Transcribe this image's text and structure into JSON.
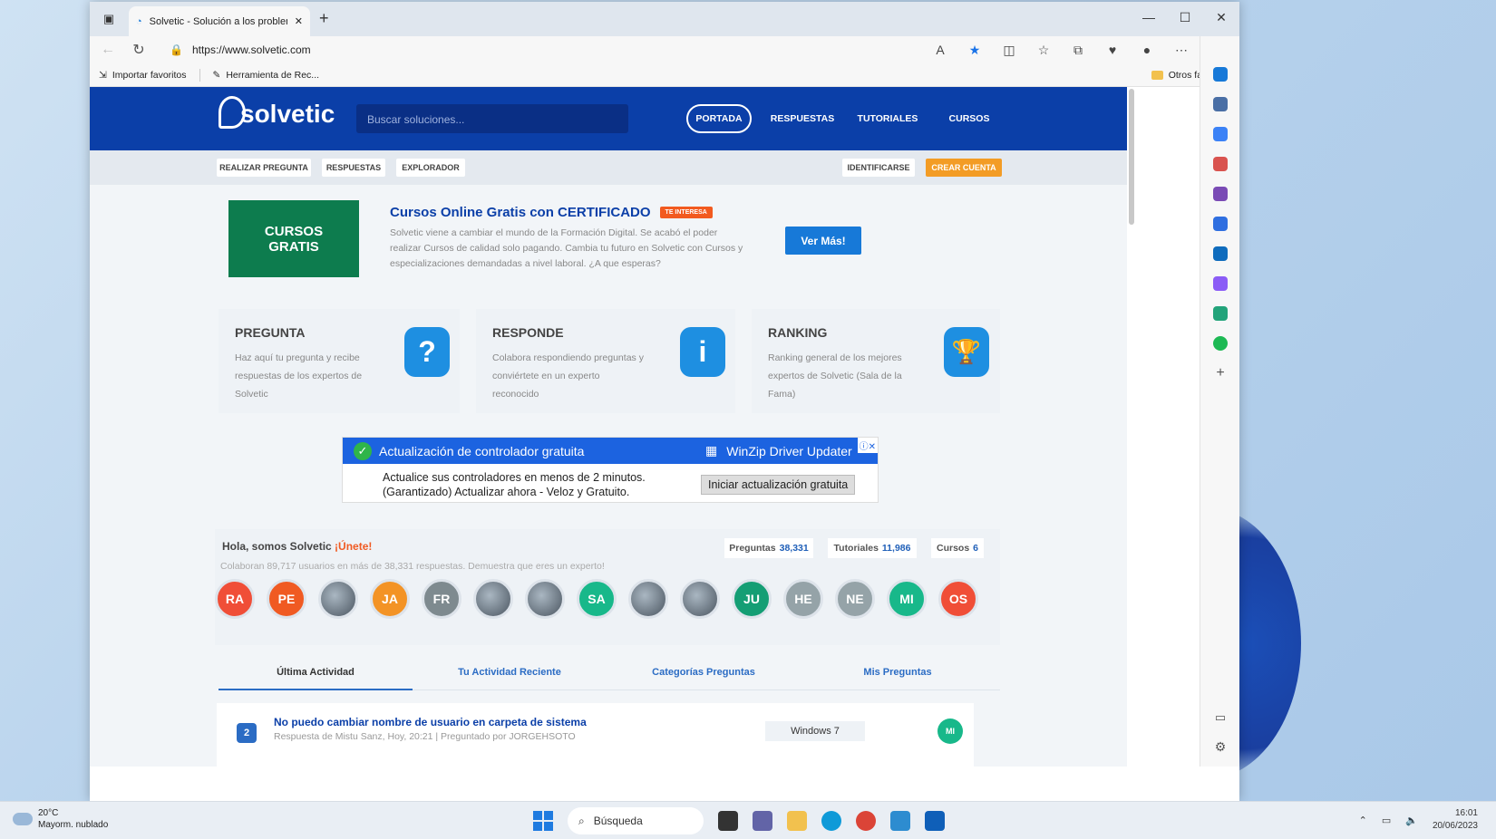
{
  "browser": {
    "tab_title": "Solvetic - Solución a los problem",
    "url": "https://www.solvetic.com",
    "favorites": [
      "Importar favoritos",
      "Herramienta de Rec..."
    ],
    "other_favorites": "Otros favoritos"
  },
  "site": {
    "search_placeholder": "Buscar soluciones...",
    "logo_text": "solvetic",
    "nav": [
      "PORTADA",
      "RESPUESTAS",
      "TUTORIALES",
      "CURSOS"
    ],
    "subnav": [
      "REALIZAR PREGUNTA",
      "RESPUESTAS",
      "EXPLORADOR"
    ],
    "login": "IDENTIFICARSE",
    "signup": "CREAR CUENTA"
  },
  "promo": {
    "image_text": "CURSOS GRATIS",
    "title": "Cursos Online Gratis con CERTIFICADO",
    "badge": "TE INTERESA",
    "body": "Solvetic viene a cambiar el mundo de la Formación Digital. Se acabó el poder realizar Cursos de calidad solo pagando. Cambia tu futuro en Solvetic con Cursos y especializaciones demandadas a nivel laboral. ¿A que esperas?",
    "button": "Ver Más!"
  },
  "cards": [
    {
      "title": "PREGUNTA",
      "body": "Haz aquí tu pregunta y recibe respuestas de los expertos de Solvetic",
      "icon": "?"
    },
    {
      "title": "RESPONDE",
      "body": "Colabora respondiendo preguntas y conviértete en un experto reconocido",
      "icon": "i"
    },
    {
      "title": "RANKING",
      "body": "Ranking general de los mejores expertos de Solvetic (Sala de la Fama)",
      "icon": "🏆"
    }
  ],
  "ad": {
    "headline": "Actualización de controlador gratuita",
    "brand": "WinZip Driver Updater",
    "body_line1": "Actualice sus controladores en menos de 2 minutos.",
    "body_line2": "(Garantizado) Actualizar ahora - Veloz y Gratuito.",
    "button": "Iniciar actualización gratuita"
  },
  "community": {
    "hello": "Hola, somos Solvetic",
    "join": "¡Únete!",
    "subtitle": "Colaboran 89,717 usuarios en más de 38,331 respuestas. Demuestra que eres un experto!",
    "stats": [
      {
        "label": "Preguntas",
        "value": "38,331"
      },
      {
        "label": "Tutoriales",
        "value": "11,986"
      },
      {
        "label": "Cursos",
        "value": "6"
      }
    ],
    "avatars": [
      {
        "text": "RA",
        "color": "#f04e37"
      },
      {
        "text": "PE",
        "color": "#f05a22"
      },
      {
        "text": "",
        "color": "photo"
      },
      {
        "text": "JA",
        "color": "#f39325"
      },
      {
        "text": "FR",
        "color": "#7e8a8f"
      },
      {
        "text": "",
        "color": "photo"
      },
      {
        "text": "",
        "color": "photo"
      },
      {
        "text": "SA",
        "color": "#18b88a"
      },
      {
        "text": "",
        "color": "photo"
      },
      {
        "text": "",
        "color": "photo"
      },
      {
        "text": "JU",
        "color": "#149e74"
      },
      {
        "text": "HE",
        "color": "#95a3a8"
      },
      {
        "text": "NE",
        "color": "#95a3a8"
      },
      {
        "text": "MI",
        "color": "#18b88a"
      },
      {
        "text": "OS",
        "color": "#f04e37"
      }
    ]
  },
  "activity_tabs": [
    "Última Actividad",
    "Tu Actividad Reciente",
    "Categorías Preguntas",
    "Mis Preguntas"
  ],
  "activity": {
    "count": "2",
    "title": "No puedo cambiar nombre de usuario en carpeta de sistema",
    "meta": "Respuesta de Mistu Sanz, Hoy, 20:21  |  Preguntado por JORGEHSOTO",
    "tag": "Windows 7",
    "avatar": "MI"
  },
  "taskbar": {
    "temp": "20°C",
    "weather": "Mayorm. nublado",
    "search": "Búsqueda",
    "time": "16:01",
    "date": "20/06/2023"
  }
}
